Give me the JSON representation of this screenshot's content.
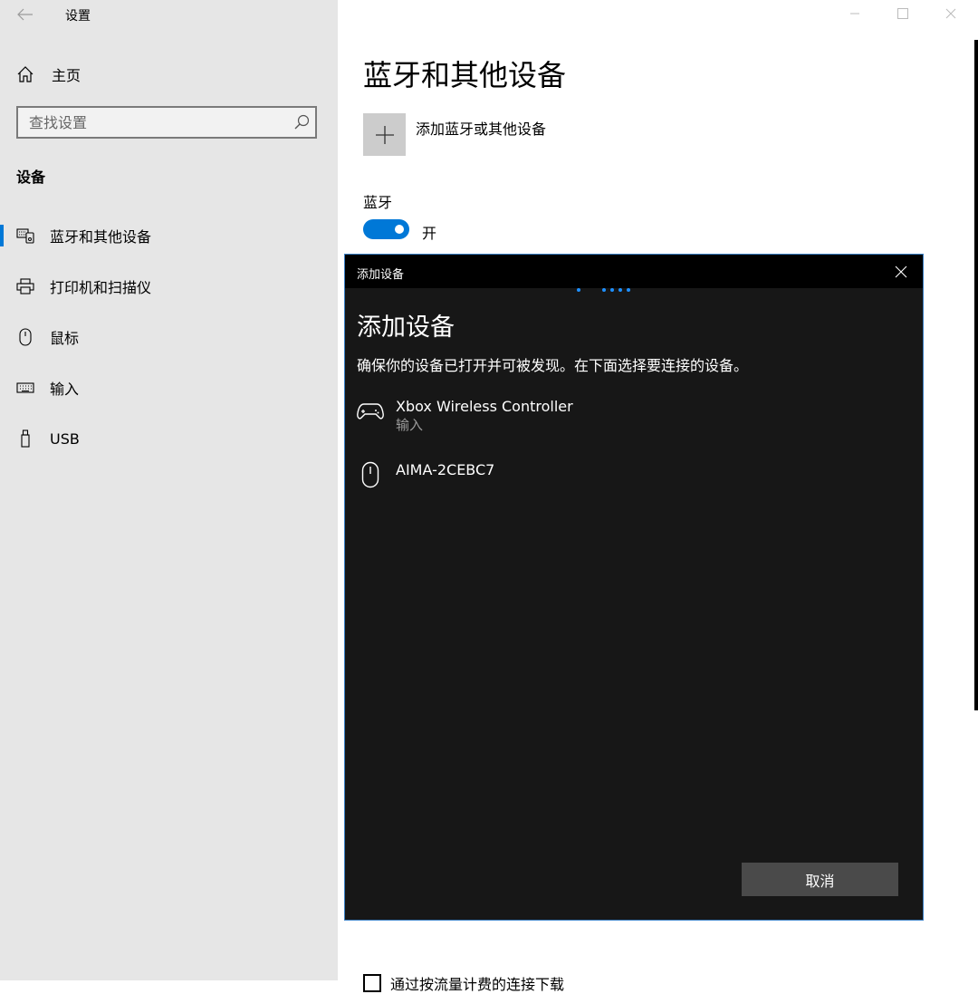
{
  "window": {
    "app_title": "设置"
  },
  "sidebar": {
    "home_label": "主页",
    "search_placeholder": "查找设置",
    "section_title": "设备",
    "items": [
      {
        "label": "蓝牙和其他设备",
        "icon": "bluetooth-devices-icon",
        "active": true
      },
      {
        "label": "打印机和扫描仪",
        "icon": "printer-icon",
        "active": false
      },
      {
        "label": "鼠标",
        "icon": "mouse-icon",
        "active": false
      },
      {
        "label": "输入",
        "icon": "keyboard-icon",
        "active": false
      },
      {
        "label": "USB",
        "icon": "usb-icon",
        "active": false
      }
    ]
  },
  "main": {
    "title": "蓝牙和其他设备",
    "add_device_label": "添加蓝牙或其他设备",
    "bluetooth_label": "蓝牙",
    "bluetooth_state": "开",
    "bluetooth_on": true,
    "partial_checkbox_label": "通过按流量计费的连接下载"
  },
  "dialog": {
    "titlebar": "添加设备",
    "heading": "添加设备",
    "description": "确保你的设备已打开并可被发现。在下面选择要连接的设备。",
    "devices": [
      {
        "name": "Xbox Wireless Controller",
        "subtitle": "输入",
        "icon": "gamepad-icon"
      },
      {
        "name": "AIMA-2CEBC7",
        "subtitle": "",
        "icon": "mouse-icon"
      }
    ],
    "cancel_label": "取消"
  },
  "colors": {
    "accent": "#0078d7",
    "sidebar_bg": "#e6e6e6",
    "dialog_bg": "#171717",
    "dialog_titlebar": "#000000",
    "dialog_border": "#3b7fc4",
    "cancel_bg": "#4a4a4a"
  }
}
